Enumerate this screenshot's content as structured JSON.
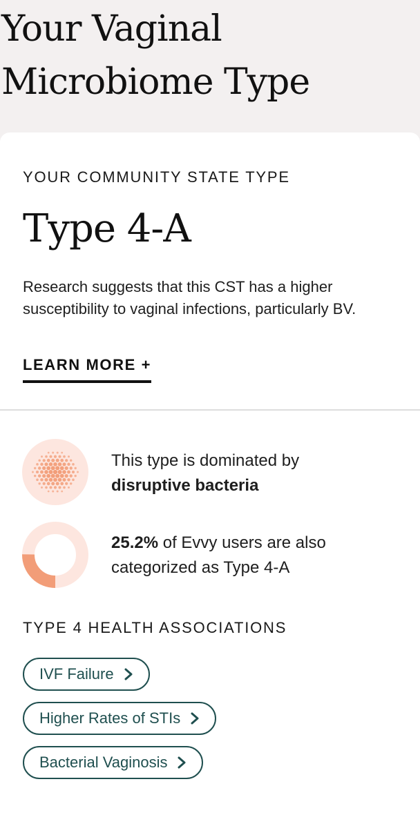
{
  "header": {
    "title_line1": "Your Vaginal",
    "title_line2": "Microbiome Type"
  },
  "cst": {
    "label": "YOUR COMMUNITY STATE TYPE",
    "type_name": "Type 4-A",
    "description": "Research suggests that this CST has a higher susceptibility to vaginal infections, particularly BV.",
    "learn_more": "LEARN MORE +"
  },
  "dominance": {
    "text_prefix": "This type is dominated by",
    "text_bold": "disruptive bacteria",
    "icon": "bacteria-cluster-icon"
  },
  "prevalence": {
    "percent_text": "25.2%",
    "percent_value": 25.2,
    "text_rest_line1": " of Evvy users are also",
    "text_rest_line2": "categorized as Type 4-A",
    "icon": "donut-chart-icon"
  },
  "associations": {
    "label": "TYPE 4 HEALTH ASSOCIATIONS",
    "items": [
      {
        "label": "IVF Failure"
      },
      {
        "label": "Higher Rates of STIs"
      },
      {
        "label": "Bacterial Vaginosis"
      }
    ]
  },
  "colors": {
    "accent_orange": "#f29d78",
    "accent_light": "#fde6df",
    "tag_teal": "#1f4f4f",
    "page_bg": "#f3f0f0"
  }
}
